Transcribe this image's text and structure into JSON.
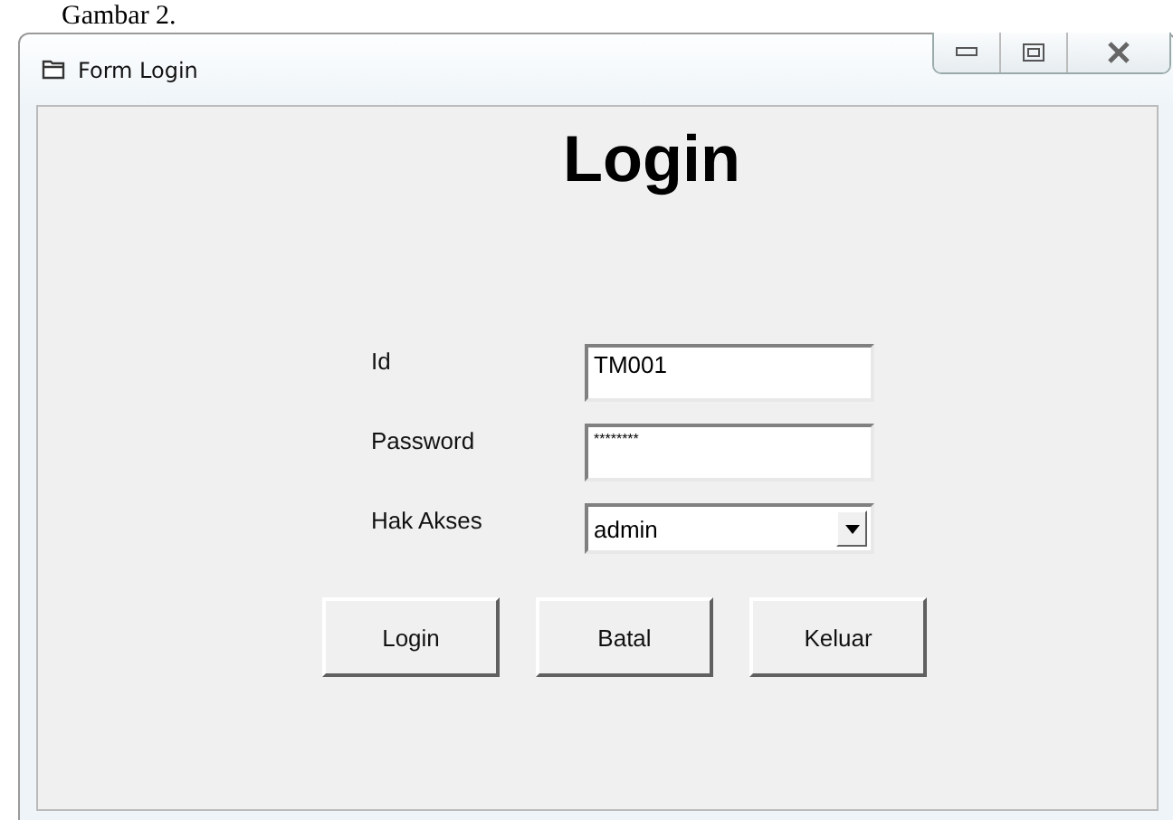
{
  "caption": "Gambar 2.",
  "window": {
    "title": "Form Login"
  },
  "heading": "Login",
  "fields": [
    {
      "label": "Id",
      "kind": "text",
      "value": "TM001"
    },
    {
      "label": "Password",
      "kind": "password",
      "value": "********"
    },
    {
      "label": "Hak Akses",
      "kind": "select",
      "value": "admin"
    }
  ],
  "buttons": [
    "Login",
    "Batal",
    "Keluar"
  ]
}
